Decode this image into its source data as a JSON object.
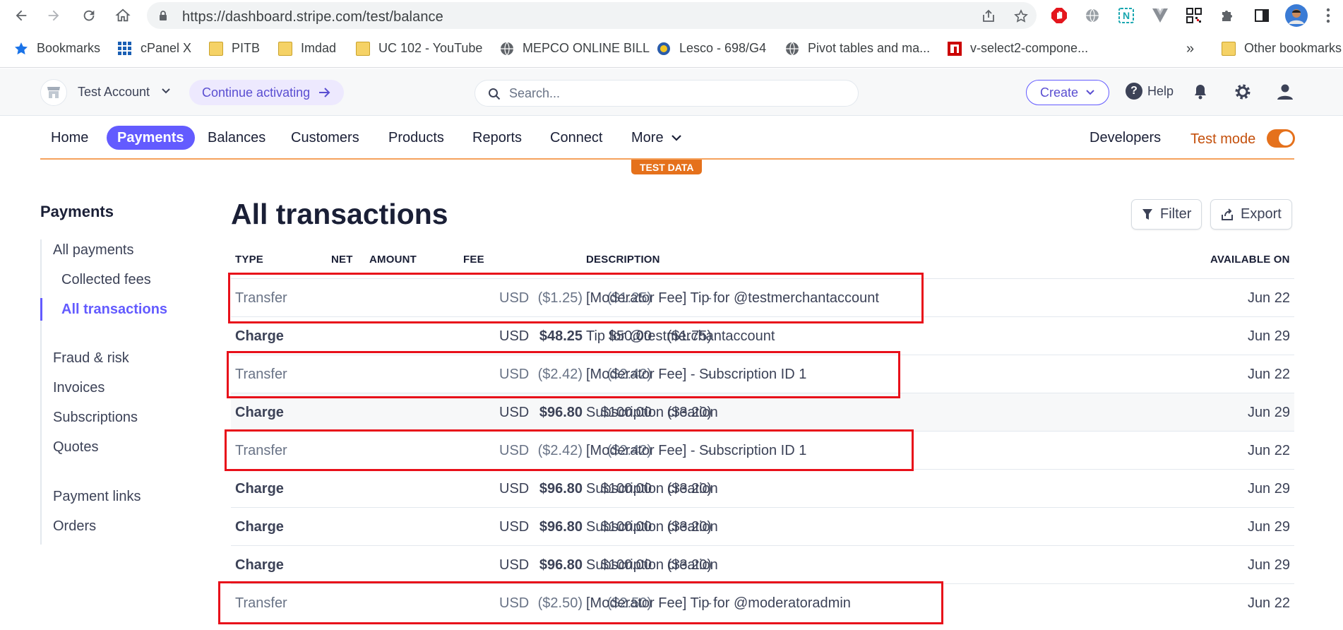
{
  "browser": {
    "url": "https://dashboard.stripe.com/test/balance",
    "bookmarks": [
      "Bookmarks",
      "cPanel X",
      "PITB",
      "Imdad",
      "UC 102 - YouTube",
      "MEPCO ONLINE BILL",
      "Lesco - 698/G4",
      "Pivot tables and ma...",
      "v-select2-compone..."
    ],
    "more_bookmarks": "»",
    "other_bookmarks": "Other bookmarks"
  },
  "header": {
    "account_name": "Test Account",
    "activate_label": "Continue activating",
    "search_placeholder": "Search...",
    "create_label": "Create",
    "help_label": "Help"
  },
  "nav": {
    "items": [
      "Home",
      "Payments",
      "Balances",
      "Customers",
      "Products",
      "Reports",
      "Connect",
      "More"
    ],
    "active": "Payments",
    "developers": "Developers",
    "test_mode": "Test mode",
    "test_mode_on": true,
    "test_badge": "TEST DATA"
  },
  "sidebar": {
    "title": "Payments",
    "items": [
      "All payments",
      "Collected fees",
      "All transactions",
      "Fraud & risk",
      "Invoices",
      "Subscriptions",
      "Quotes",
      "Payment links",
      "Orders"
    ],
    "active": "All transactions"
  },
  "main": {
    "title": "All transactions",
    "filter_label": "Filter",
    "export_label": "Export",
    "columns": [
      "TYPE",
      "NET",
      "AMOUNT",
      "FEE",
      "DESCRIPTION",
      "AVAILABLE ON"
    ],
    "rows": [
      {
        "type": "Transfer",
        "net": "($1.25)",
        "amount": "($1.25)",
        "fee": "-",
        "currency": "USD",
        "description": "[Moderator Fee] Tip for @testmerchantaccount",
        "available_on": "Jun 22"
      },
      {
        "type": "Charge",
        "net": "$48.25",
        "amount": "$50.00",
        "fee": "($1.75)",
        "currency": "USD",
        "description": "Tip for @testmerchantaccount",
        "available_on": "Jun 29"
      },
      {
        "type": "Transfer",
        "net": "($2.42)",
        "amount": "($2.42)",
        "fee": "-",
        "currency": "USD",
        "description": "[Moderator Fee] - Subscription ID 1",
        "available_on": "Jun 22"
      },
      {
        "type": "Charge",
        "net": "$96.80",
        "amount": "$100.00",
        "fee": "($3.20)",
        "currency": "USD",
        "description": "Subscription creation",
        "available_on": "Jun 29"
      },
      {
        "type": "Transfer",
        "net": "($2.42)",
        "amount": "($2.42)",
        "fee": "-",
        "currency": "USD",
        "description": "[Moderator Fee] - Subscription ID 1",
        "available_on": "Jun 22"
      },
      {
        "type": "Charge",
        "net": "$96.80",
        "amount": "$100.00",
        "fee": "($3.20)",
        "currency": "USD",
        "description": "Subscription creation",
        "available_on": "Jun 29"
      },
      {
        "type": "Charge",
        "net": "$96.80",
        "amount": "$100.00",
        "fee": "($3.20)",
        "currency": "USD",
        "description": "Subscription creation",
        "available_on": "Jun 29"
      },
      {
        "type": "Charge",
        "net": "$96.80",
        "amount": "$100.00",
        "fee": "($3.20)",
        "currency": "USD",
        "description": "Subscription creation",
        "available_on": "Jun 29"
      },
      {
        "type": "Transfer",
        "net": "($2.50)",
        "amount": "($2.50)",
        "fee": "-",
        "currency": "USD",
        "description": "[Moderator Fee] Tip for @moderatoradmin",
        "available_on": "Jun 22"
      }
    ]
  },
  "colors": {
    "accent": "#635bff",
    "test_mode": "#e5711c",
    "highlight_box": "#e8101a"
  }
}
